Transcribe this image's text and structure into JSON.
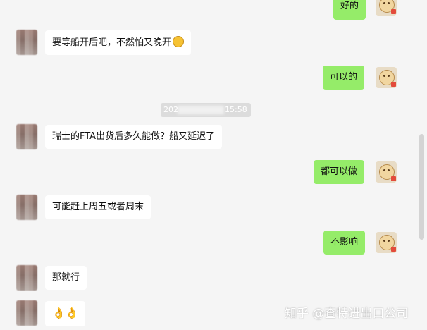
{
  "messages": [
    {
      "side": "right",
      "text": "好的"
    },
    {
      "side": "left",
      "text": "要等船开后吧，不然怕又晚开"
    },
    {
      "side": "right",
      "text": "可以的"
    },
    {
      "side": "left",
      "text": "瑞士的FTA出货后多久能做？船又延迟了"
    },
    {
      "side": "right",
      "text": "都可以做"
    },
    {
      "side": "left",
      "text": "可能赶上周五或者周末"
    },
    {
      "side": "right",
      "text": "不影响"
    },
    {
      "side": "left",
      "text": "那就行"
    },
    {
      "side": "left",
      "text": "👌👌"
    }
  ],
  "timestamp": {
    "prefix": "202",
    "suffix": "15:58"
  },
  "watermark": "知乎 @查特进出口公司",
  "colors": {
    "background": "#f5f5f5",
    "left_bubble": "#ffffff",
    "right_bubble": "#95ec69"
  }
}
